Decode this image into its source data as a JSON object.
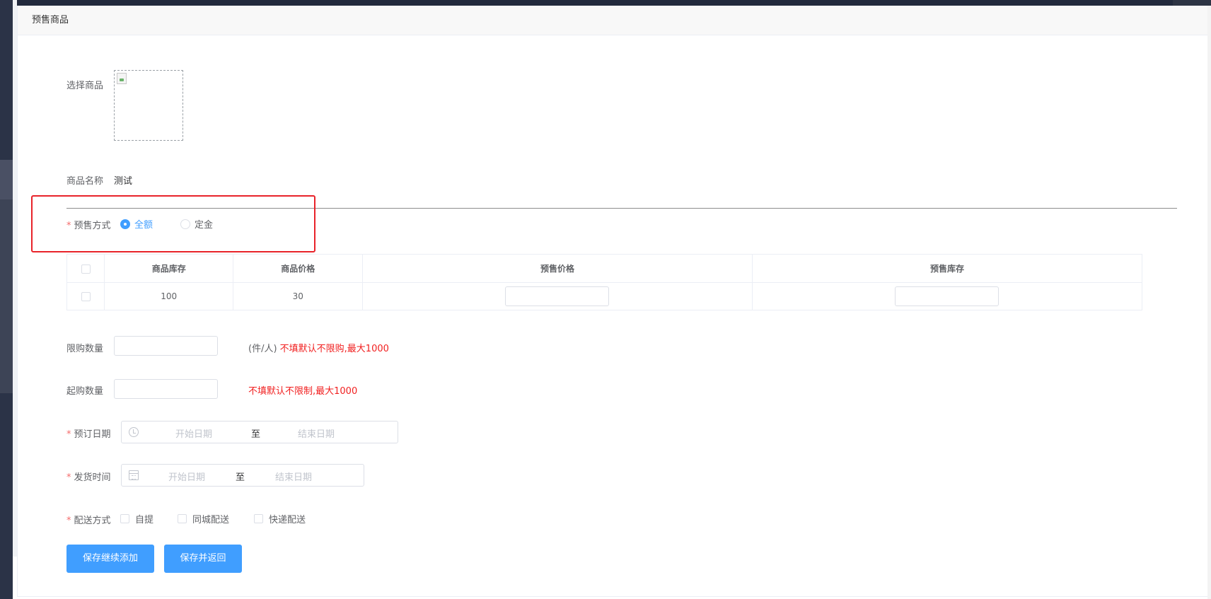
{
  "header": {
    "title": "预售商品"
  },
  "form": {
    "select_goods_label": "选择商品",
    "goods_name_label": "商品名称",
    "goods_name_value": "测试",
    "presale_mode": {
      "label": "预售方式",
      "options": [
        {
          "label": "全额",
          "checked": true
        },
        {
          "label": "定金",
          "checked": false
        }
      ]
    },
    "sku_table": {
      "headers": [
        "商品库存",
        "商品价格",
        "预售价格",
        "预售库存"
      ],
      "rows": [
        {
          "stock": "100",
          "price": "30",
          "presale_price": "",
          "presale_stock": ""
        }
      ]
    },
    "limit_qty": {
      "label": "限购数量",
      "value": "",
      "unit": "(件/人)",
      "hint": "不填默认不限购,最大1000"
    },
    "min_qty": {
      "label": "起购数量",
      "value": "",
      "hint": "不填默认不限制,最大1000"
    },
    "order_date": {
      "label": "预订日期",
      "start_placeholder": "开始日期",
      "separator": "至",
      "end_placeholder": "结束日期",
      "icon": "clock-icon"
    },
    "ship_time": {
      "label": "发货时间",
      "start_placeholder": "开始日期",
      "separator": "至",
      "end_placeholder": "结束日期",
      "icon": "calendar-icon"
    },
    "delivery": {
      "label": "配送方式",
      "options": [
        "自提",
        "同城配送",
        "快递配送"
      ]
    },
    "required_mark": "*"
  },
  "buttons": {
    "save_continue": "保存继续添加",
    "save_return": "保存并返回"
  },
  "colors": {
    "primary": "#409eff",
    "required": "#f56c6c",
    "hint": "#f11f1f",
    "annotation_box": "#e8232a"
  }
}
